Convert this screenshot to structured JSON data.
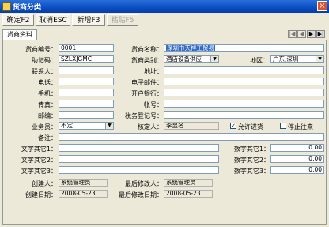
{
  "window": {
    "title": "货商分类",
    "close_label": "×"
  },
  "toolbar": {
    "confirm": "确定F2",
    "cancel": "取消ESC",
    "new": "新增F3",
    "paste": "粘贴F5"
  },
  "tabs": {
    "active": "货商资料"
  },
  "nav": {
    "first": "|◀",
    "prev": "◀",
    "next": "▶",
    "last": "▶|"
  },
  "form": {
    "code_label": "货商编号：",
    "code": "0001",
    "name_label": "货商名称：",
    "name": "深圳市天祥工贸易",
    "mnemonic_label": "助记码：",
    "mnemonic": "SZLXJGMC",
    "category_label": "货商类别：",
    "category": "酒店设备供应",
    "region_label": "地区：",
    "region": "广东,深圳",
    "contact_label": "联系人：",
    "contact": "",
    "address_label": "地址：",
    "address": "",
    "phone_label": "电话：",
    "phone": "",
    "email_label": "电子邮件：",
    "email": "",
    "mobile_label": "手机：",
    "mobile": "",
    "bank_label": "开户银行：",
    "bank": "",
    "fax_label": "传真：",
    "fax": "",
    "account_label": "帐号：",
    "account": "",
    "zip_label": "邮编：",
    "zip": "",
    "taxid_label": "税务登记号：",
    "taxid": "",
    "business_label": "业务员：",
    "business": "不定",
    "reviewer_label": "核定人：",
    "reviewer": "李显名",
    "allow_label": "允许进货",
    "stop_label": "停止往来",
    "remark_label": "备注：",
    "remark": "",
    "text1_label": "文字其它1：",
    "text1": "",
    "text2_label": "文字其它2：",
    "text2": "",
    "text3_label": "文字其它3：",
    "text3": "",
    "num1_label": "数字其它1：",
    "num1": "0.00",
    "num2_label": "数字其它2：",
    "num2": "0.00",
    "num3_label": "数字其它3：",
    "num3": "0.00",
    "creator_label": "创建人：",
    "creator": "系统管理员",
    "modifier_label": "最后修改人：",
    "modifier": "系统管理员",
    "created_label": "创建日期：",
    "created": "2008-05-23",
    "modified_label": "最后修改日期：",
    "modified": "2008-05-23"
  },
  "checks": {
    "allow": "✓",
    "stop": ""
  }
}
